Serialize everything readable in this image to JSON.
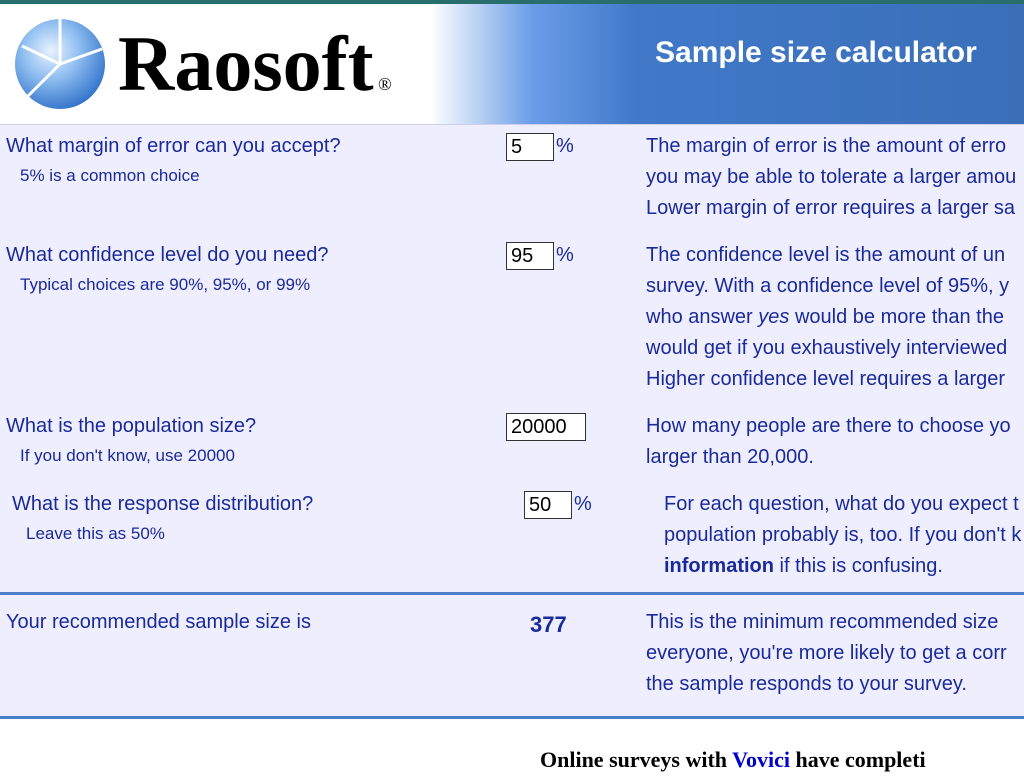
{
  "brand": {
    "name": "Raosoft",
    "registered": "®"
  },
  "header": {
    "title": "Sample size calculator"
  },
  "form": {
    "margin": {
      "question": "What margin of error can you accept?",
      "hint": "5% is a common choice",
      "value": "5",
      "unit": "%",
      "desc1": "The margin of error is the amount of erro",
      "desc2": "you may be able to tolerate a larger amou",
      "desc3": "Lower margin of error requires a larger sa"
    },
    "confidence": {
      "question": "What confidence level do you need?",
      "hint": "Typical choices are 90%, 95%, or 99%",
      "value": "95",
      "unit": "%",
      "desc1": "The confidence level is the amount of un",
      "desc2": "survey. With a confidence level of 95%, y",
      "desc3a": "who answer ",
      "desc3b": "yes",
      "desc3c": " would be more than the ",
      "desc4": "would get if you exhaustively interviewed",
      "desc5": "Higher confidence level requires a larger"
    },
    "population": {
      "question": "What is the population size?",
      "hint": "If you don't know, use 20000",
      "value": "20000",
      "desc1": "How many people are there to choose yo",
      "desc2": "larger than 20,000."
    },
    "response": {
      "question": "What is the response distribution?",
      "hint": "Leave this as 50%",
      "value": "50",
      "unit": "%",
      "desc1": "For each question, what do you expect t",
      "desc2": "population probably is, too. If you don't k",
      "desc3a": "information",
      "desc3b": " if this is confusing."
    },
    "result": {
      "label": "Your recommended sample size is",
      "value": "377",
      "desc1": "This is the minimum recommended size ",
      "desc2": "everyone, you're more likely to get a corr",
      "desc3": "the sample responds to your survey."
    }
  },
  "footer": {
    "pre": "Online surveys with ",
    "link": "Vovici",
    "post": " have completi"
  }
}
